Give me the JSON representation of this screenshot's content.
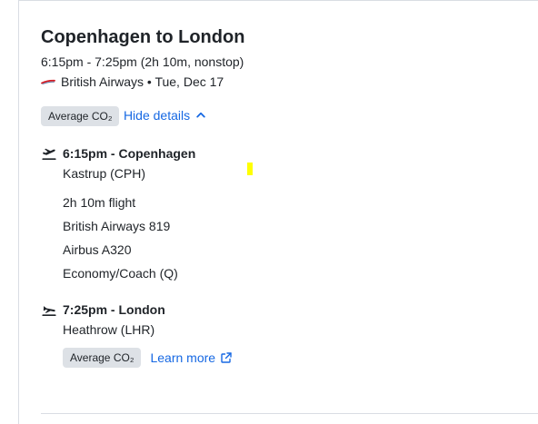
{
  "flight": {
    "title": "Copenhagen to London",
    "time_summary": "6:15pm - 7:25pm (2h 10m, nonstop)",
    "airline_date": "British Airways • Tue, Dec 17",
    "emissions_badge": "Average CO₂",
    "details_toggle": "Hide details"
  },
  "segments": {
    "departure": {
      "title": "6:15pm - Copenhagen",
      "airport": "Kastrup (CPH)"
    },
    "leg": {
      "duration": "2h 10m flight",
      "flight_number": "British Airways 819",
      "aircraft": "Airbus A320",
      "cabin": "Economy/Coach (Q)"
    },
    "arrival": {
      "title": "7:25pm - London",
      "airport": "Heathrow (LHR)",
      "emissions_badge": "Average CO₂",
      "learn_more": "Learn more"
    }
  },
  "icons": {
    "airline_logo": "british-airways-logo",
    "toggle": "chevron-up-icon",
    "departure": "takeoff-plane-icon",
    "arrival": "landing-plane-icon",
    "external": "external-link-icon"
  },
  "colors": {
    "text": "#1f2328",
    "link": "#1668e3",
    "badge_bg": "#dde1e6",
    "divider": "#d9dde3",
    "highlight": "#ffff00",
    "airline_red": "#d71920"
  }
}
